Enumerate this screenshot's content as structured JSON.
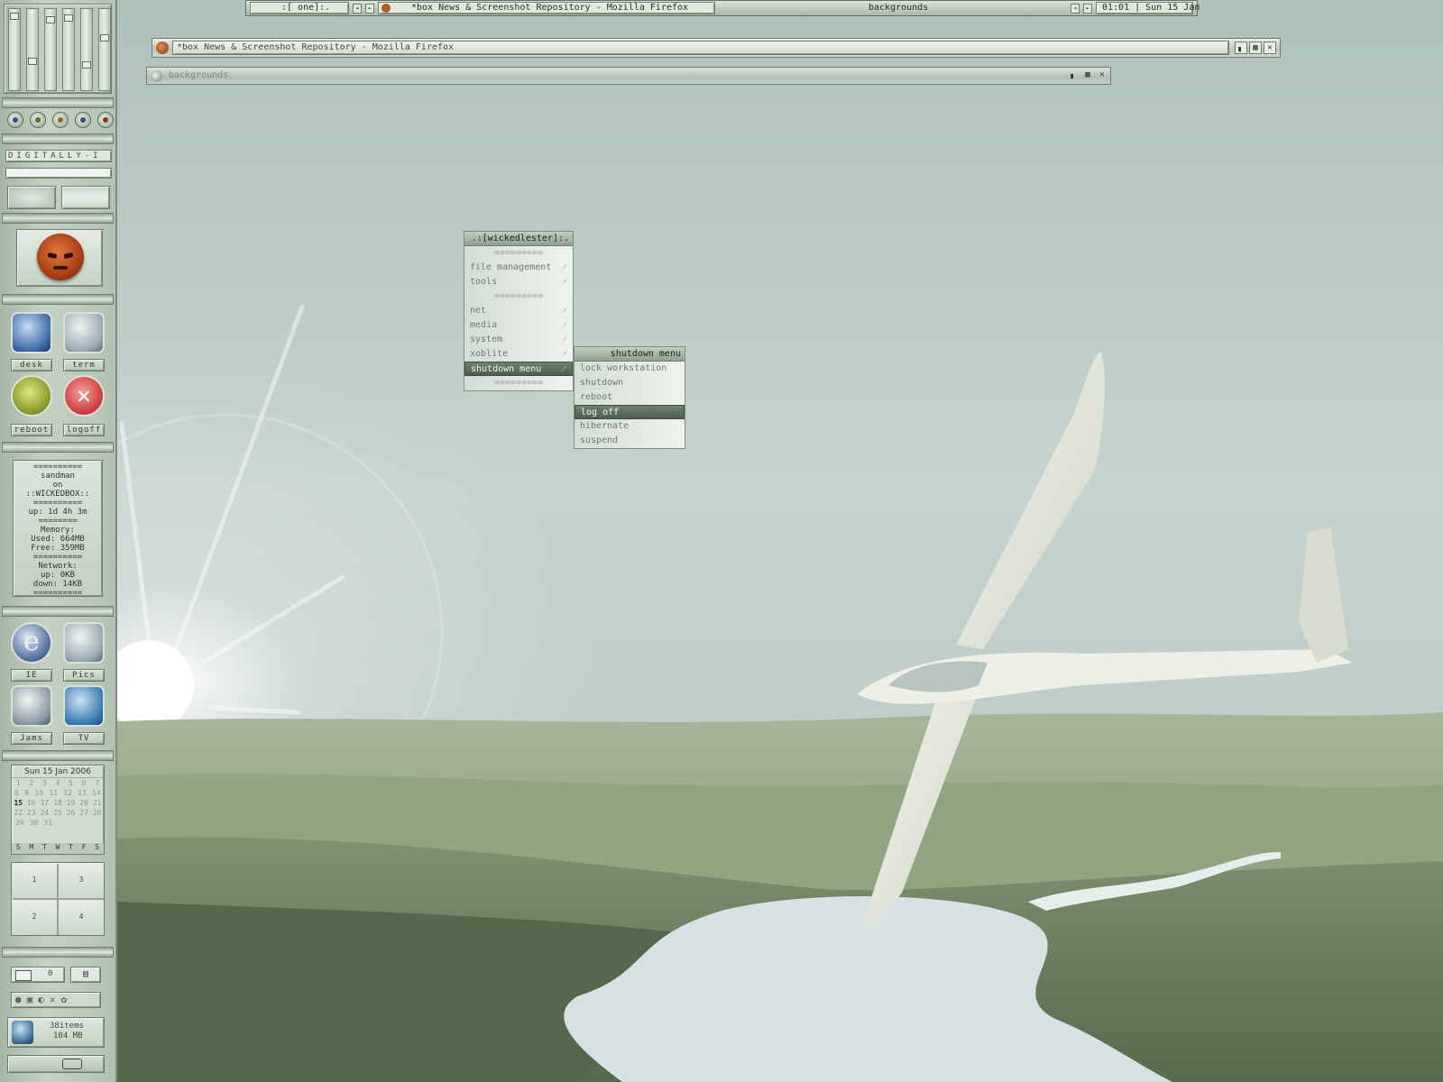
{
  "taskbar": {
    "workspace_label": ":[ one]:.",
    "task_title": "*box News & Screenshot Repository - Mozilla Firefox",
    "active_window": "backgrounds",
    "clock": "01:01 | Sun 15 Jan"
  },
  "firefox_window": {
    "title": "*box News & Screenshot Repository - Mozilla Firefox"
  },
  "backgrounds_window": {
    "title": "backgrounds"
  },
  "root_menu": {
    "title": ".:[wickedlester]:.",
    "divider": "=========",
    "items": [
      {
        "label": "file management",
        "has_submenu": true
      },
      {
        "label": "tools",
        "has_submenu": true
      },
      {
        "label": "net",
        "has_submenu": true
      },
      {
        "label": "media",
        "has_submenu": true
      },
      {
        "label": "system",
        "has_submenu": true
      },
      {
        "label": "xoblite",
        "has_submenu": true
      },
      {
        "label": "shutdown menu",
        "has_submenu": true,
        "selected": true
      }
    ]
  },
  "shutdown_menu": {
    "title": "shutdown menu",
    "items": [
      {
        "label": "lock workstation"
      },
      {
        "label": "shutdown"
      },
      {
        "label": "reboot"
      },
      {
        "label": "log off",
        "selected": true
      },
      {
        "label": "hibernate"
      },
      {
        "label": "suspend"
      }
    ]
  },
  "dock": {
    "media_buttons": [
      "prev",
      "play",
      "pause",
      "next",
      "stop"
    ],
    "ticker": "DIGITALLY-I",
    "shortcuts_top": [
      {
        "label": "desk",
        "icon": "desktop-icon"
      },
      {
        "label": "term",
        "icon": "terminal-icon"
      },
      {
        "label": "reboot",
        "icon": "reboot-icon"
      },
      {
        "label": "logoff",
        "icon": "logoff-icon"
      }
    ],
    "sysinfo": [
      "==========",
      "sandman",
      "on",
      "::WICKEDBOX::",
      "==========",
      "up: 1d 4h 3m",
      "========",
      "Memory:",
      "Used: 664MB",
      "Free: 359MB",
      "==========",
      "Network:",
      "up: 0KB",
      "down: 14KB",
      "=========="
    ],
    "shortcuts_bottom": [
      {
        "label": "IE",
        "icon": "ie-icon"
      },
      {
        "label": "Pics",
        "icon": "pics-icon"
      },
      {
        "label": "Jams",
        "icon": "jams-icon"
      },
      {
        "label": "TV",
        "icon": "tv-icon"
      }
    ],
    "calendar": {
      "header": "Sun 15 Jan  2006",
      "rows": [
        [
          "1",
          "2",
          "3",
          "4",
          "5",
          "6",
          "7"
        ],
        [
          "8",
          "9",
          "10",
          "11",
          "12",
          "13",
          "14"
        ],
        [
          "15",
          "16",
          "17",
          "18",
          "19",
          "20",
          "21"
        ],
        [
          "22",
          "23",
          "24",
          "25",
          "26",
          "27",
          "28"
        ],
        [
          "29",
          "30",
          "31"
        ]
      ],
      "today": "15",
      "weekdays": [
        "S",
        "M",
        "T",
        "W",
        "T",
        "F",
        "S"
      ]
    },
    "pager": [
      "1",
      "3",
      "2",
      "4"
    ],
    "mail_count": "0",
    "recycle": {
      "items": "38items",
      "size": "104 MB"
    }
  },
  "colors": {
    "sky": "#c4d3cd",
    "hills": "#6f8560",
    "water": "#d6e1e1",
    "glider": "#e9ece2",
    "menu_selected": "#56685a"
  }
}
